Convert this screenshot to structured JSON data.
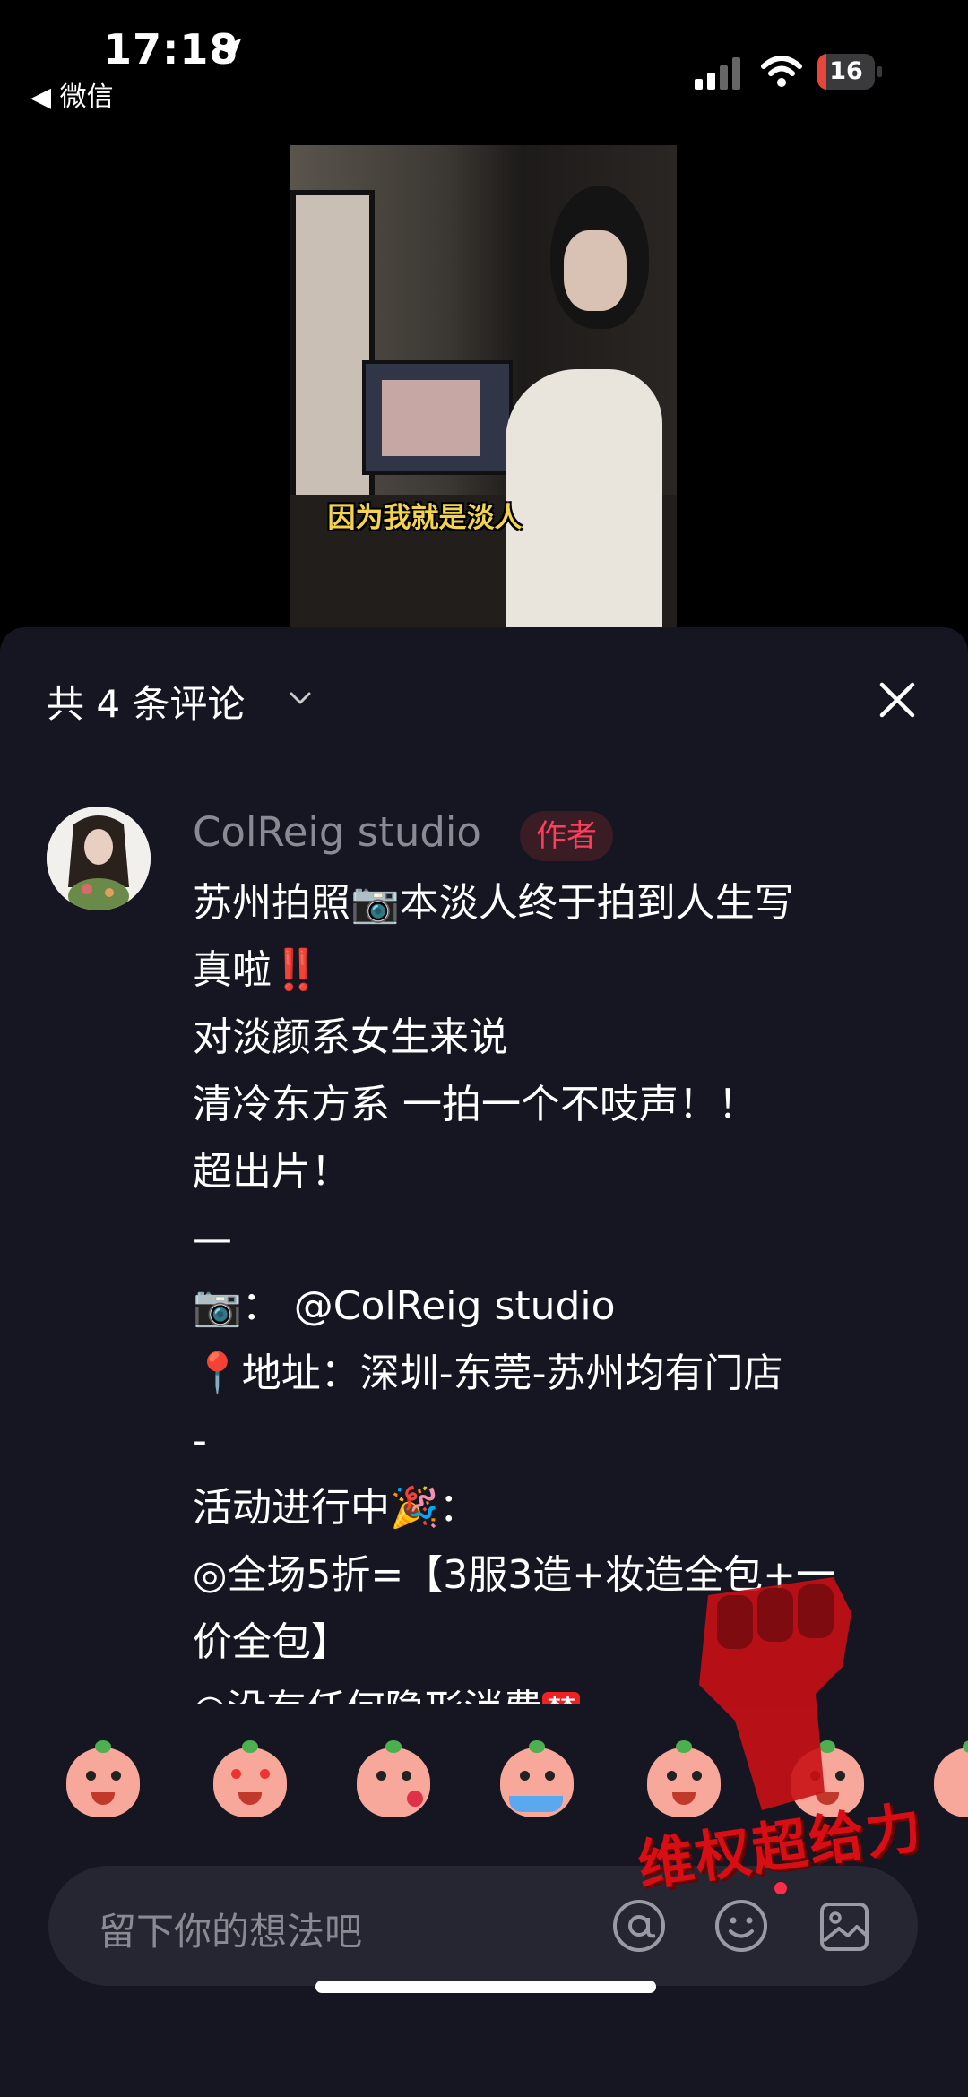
{
  "status_bar": {
    "time": "17:18",
    "back_label": "◀ 微信",
    "battery_level": "16",
    "battery_fraction": 0.16,
    "battery_color": "#e8453c"
  },
  "video": {
    "caption": "因为我就是淡人"
  },
  "comments_panel": {
    "title": "共 4 条评论",
    "comment": {
      "author": "ColReig studio",
      "badge": "作者",
      "lines": [
        "苏州拍照📷本淡人终于拍到人生写",
        "真啦",
        "对淡颜系女生来说",
        "清冷东方系 一拍一个不吱声！！",
        "超出片！",
        "—",
        "📷：  @ColReig studio",
        "📍地址：深圳-东莞-苏州均有门店",
        "-",
        "活动进行中🎉：",
        "◎全场5折=【3服3造+妆造全包+一",
        "价全包】",
        "◎没有任何隐形消费"
      ],
      "alarm_mark": "‼️",
      "forbid_mark": "禁"
    }
  },
  "emoji_bar": {
    "items": [
      "shy-face",
      "star-eyes-face",
      "wink-kiss-face",
      "crying-face",
      "laugh-cry-face",
      "sweat-face",
      "peek-face"
    ]
  },
  "input": {
    "placeholder": "留下你的想法吧"
  },
  "watermark": {
    "text": "维权超给力"
  },
  "colors": {
    "panel_bg": "#161622",
    "accent_red": "#ff3d5c",
    "badge_bg": "#3a1c25"
  }
}
